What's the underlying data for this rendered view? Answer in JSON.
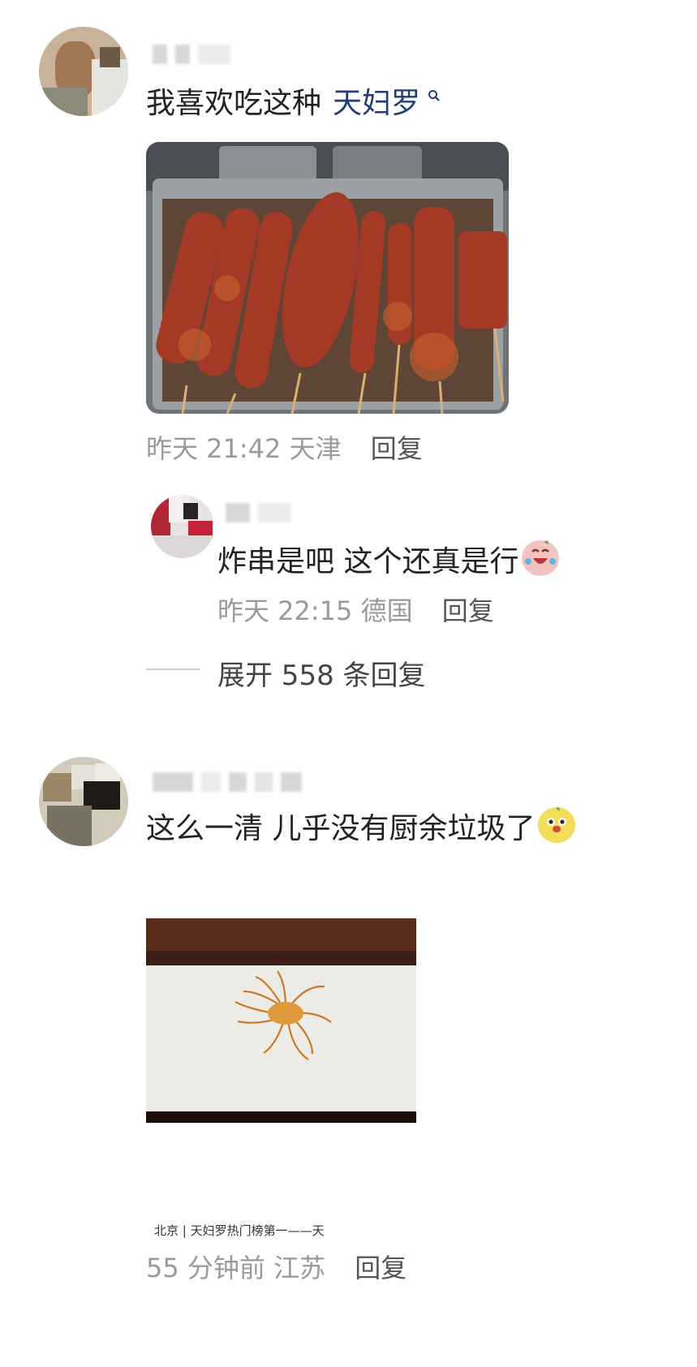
{
  "comments": [
    {
      "text": "我喜欢吃这种",
      "topic": "天妇罗",
      "time": "昨天 21:42",
      "location": "天津",
      "reply_label": "回复"
    },
    {
      "text": "这么一清 儿乎没有厨余垃圾了",
      "caption": "北京 | 天妇罗热门榜第一——天",
      "time": "55 分钟前",
      "location": "江苏",
      "reply_label": "回复"
    }
  ],
  "reply": {
    "text": "炸串是吧 这个还真是行",
    "time": "昨天 22:15",
    "location": "德国",
    "reply_label": "回复"
  },
  "expand_label": "展开 558 条回复",
  "icons": {
    "topic_search": "search-icon",
    "laugh_cry_emoji": "laugh-cry-emoji-icon",
    "yellow_face_emoji": "yellow-face-emoji-icon"
  }
}
